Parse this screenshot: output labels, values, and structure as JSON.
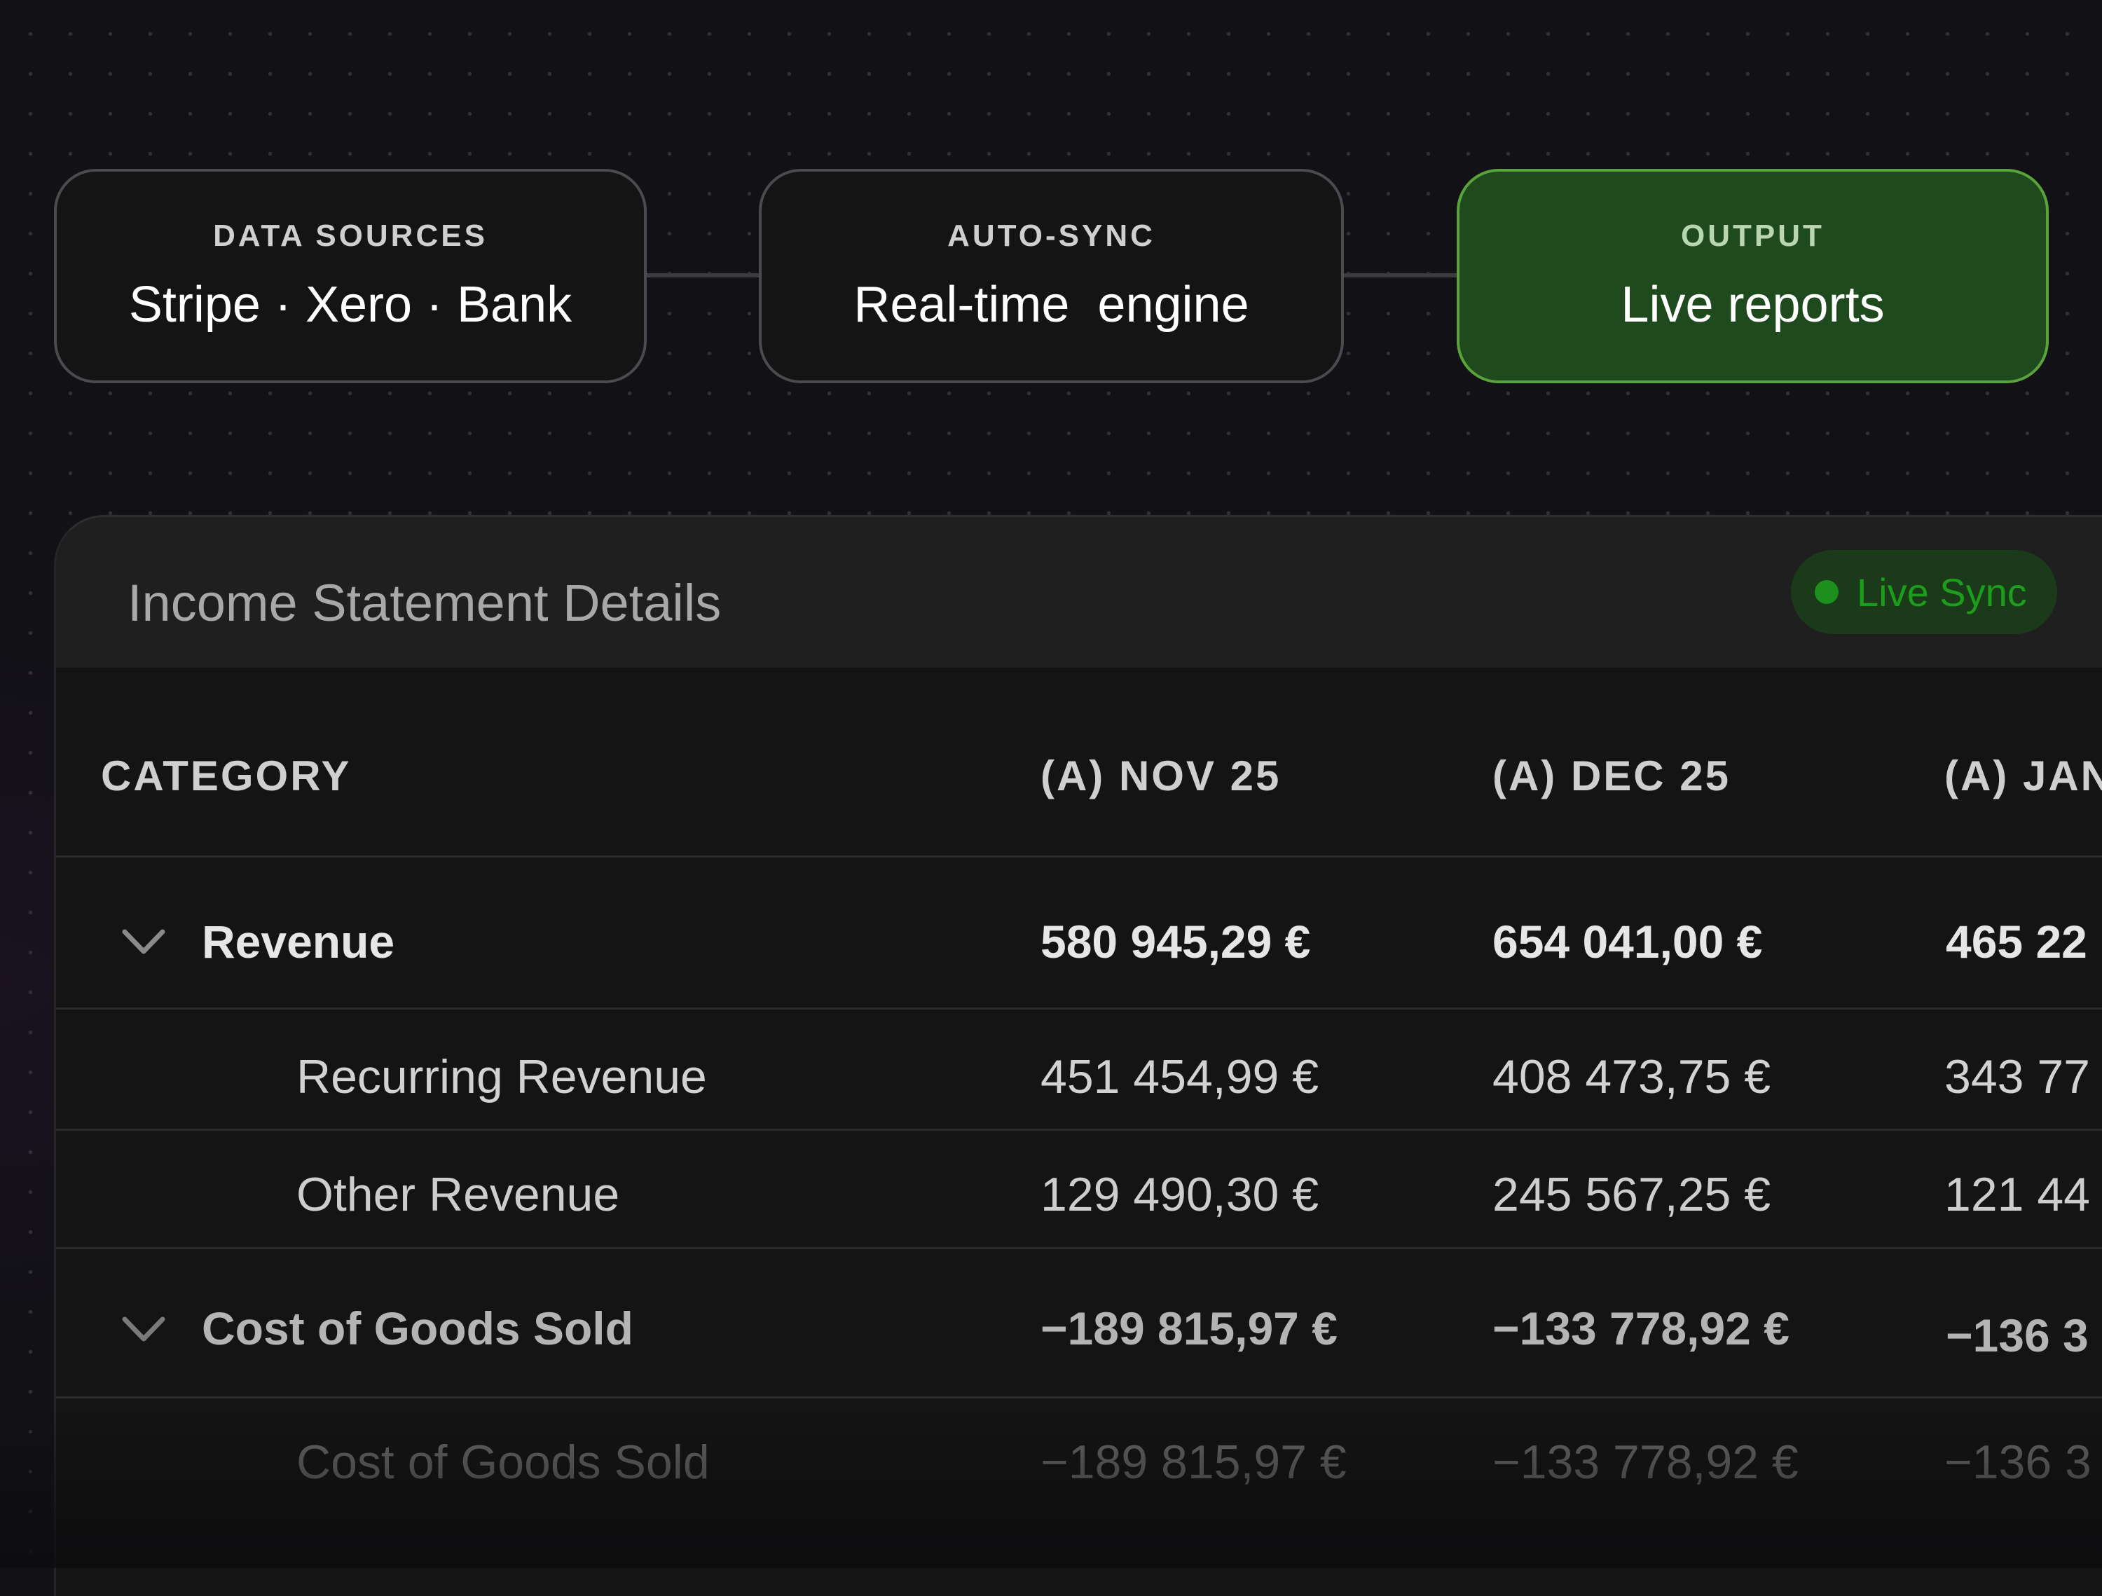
{
  "flow": {
    "nodes": [
      {
        "label": "DATA SOURCES",
        "value": "Stripe · Xero · Bank"
      },
      {
        "label": "AUTO-SYNC",
        "value": "Real-time  engine"
      },
      {
        "label": "OUTPUT",
        "value": "Live reports"
      }
    ]
  },
  "panel": {
    "title": "Income Statement Details",
    "badge": "Live Sync",
    "columns": [
      "CATEGORY",
      "(A) NOV 25",
      "(A) DEC 25",
      "(A) JAN"
    ]
  },
  "table": {
    "rows": [
      {
        "label": "Revenue",
        "nov": "580 945,29 €",
        "dec": "654 041,00 €",
        "jan": "465 22"
      },
      {
        "label": "Recurring Revenue",
        "nov": "451 454,99 €",
        "dec": "408 473,75 €",
        "jan": "343 77"
      },
      {
        "label": "Other Revenue",
        "nov": "129 490,30 €",
        "dec": "245 567,25 €",
        "jan": "121 44"
      },
      {
        "label": "Cost of Goods Sold",
        "nov": "−189 815,97 €",
        "dec": "−133 778,92 €",
        "jan": "−136 3"
      },
      {
        "label": "Cost of Goods Sold",
        "nov": "−189 815,97 €",
        "dec": "−133 778,92 €",
        "jan": "−136 3"
      }
    ]
  },
  "colors": {
    "accent_green": "#1c9d1c",
    "active_node": "#1e4a1e"
  },
  "icons": {
    "expand": "chevron-down-icon",
    "status": "live-dot-icon"
  }
}
